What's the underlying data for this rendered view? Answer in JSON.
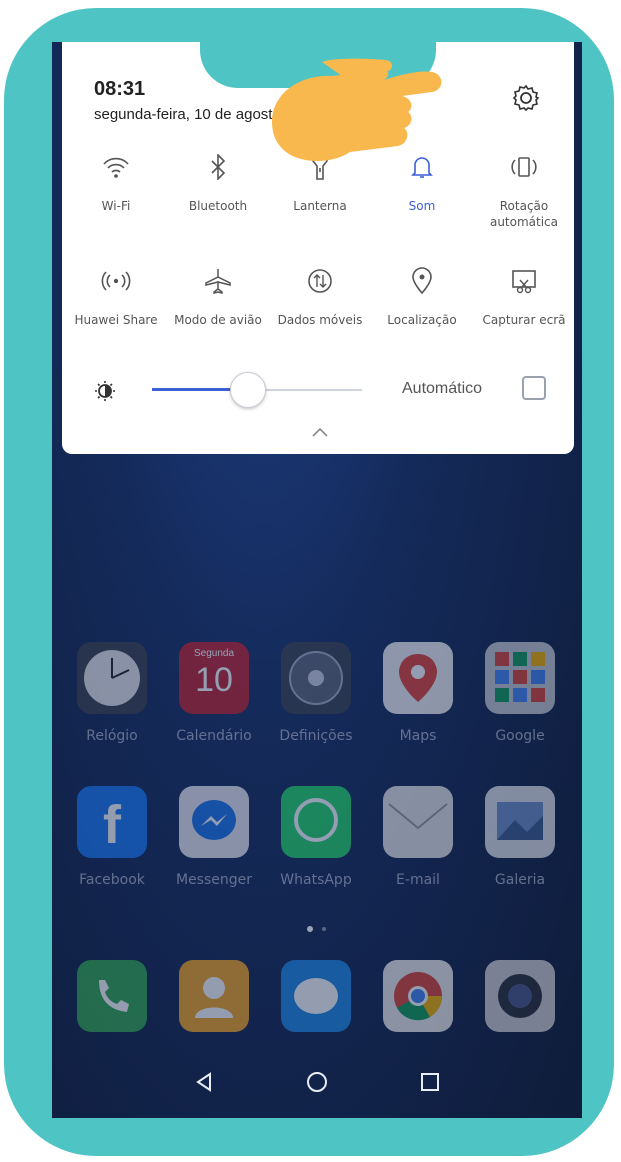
{
  "status": {
    "time": "08:31",
    "date": "segunda-feira, 10 de agosto"
  },
  "quick_settings": {
    "row1": [
      {
        "label": "Wi-Fi",
        "icon": "wifi-icon"
      },
      {
        "label": "Bluetooth",
        "icon": "bluetooth-icon"
      },
      {
        "label": "Lanterna",
        "icon": "flashlight-icon"
      },
      {
        "label": "Som",
        "icon": "bell-icon",
        "active": true
      },
      {
        "label": "Rotação automática",
        "icon": "rotation-icon"
      }
    ],
    "row2": [
      {
        "label": "Huawei Share",
        "icon": "huawei-share-icon"
      },
      {
        "label": "Modo de avião",
        "icon": "airplane-icon"
      },
      {
        "label": "Dados móveis",
        "icon": "mobile-data-icon"
      },
      {
        "label": "Localização",
        "icon": "location-icon"
      },
      {
        "label": "Capturar ecrã",
        "icon": "screenshot-icon"
      }
    ],
    "brightness": {
      "level": 0.45,
      "auto_label": "Automático",
      "auto_checked": false
    }
  },
  "home": {
    "row1": [
      {
        "name": "Relógio",
        "icon": "clock-icon"
      },
      {
        "name": "Calendário",
        "icon": "calendar-icon",
        "day_label": "Segunda",
        "day_number": "10"
      },
      {
        "name": "Definições",
        "icon": "settings-icon"
      },
      {
        "name": "Maps",
        "icon": "maps-icon"
      },
      {
        "name": "Google",
        "icon": "google-folder-icon"
      }
    ],
    "row2": [
      {
        "name": "Facebook",
        "icon": "facebook-icon"
      },
      {
        "name": "Messenger",
        "icon": "messenger-icon"
      },
      {
        "name": "WhatsApp",
        "icon": "whatsapp-icon"
      },
      {
        "name": "E-mail",
        "icon": "email-icon"
      },
      {
        "name": "Galeria",
        "icon": "gallery-icon"
      }
    ],
    "dock": [
      "phone-icon",
      "contacts-icon",
      "messages-icon",
      "chrome-icon",
      "camera-icon"
    ]
  },
  "colors": {
    "frame": "#4fc4c4",
    "accent": "#3a5fd6",
    "hand": "#f8b84e"
  }
}
